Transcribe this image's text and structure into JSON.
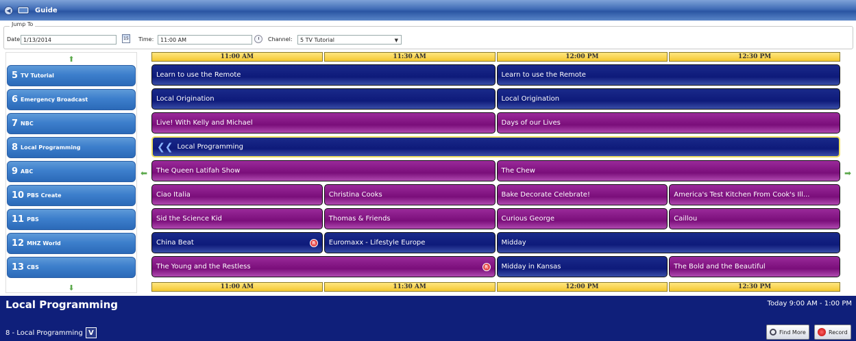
{
  "window": {
    "title": "Guide"
  },
  "jump_to": {
    "legend": "Jump To",
    "date_label": "Date:",
    "date_value": "1/13/2014",
    "calendar_day": "15",
    "time_label": "Time:",
    "time_value": "11:00 AM",
    "channel_label": "Channel:",
    "channel_value": "5 TV Tutorial"
  },
  "time_slots": [
    "11:00 AM",
    "11:30 AM",
    "12:00 PM",
    "12:30 PM"
  ],
  "channels": [
    {
      "num": "5",
      "name": "TV Tutorial"
    },
    {
      "num": "6",
      "name": "Emergency Broadcast"
    },
    {
      "num": "7",
      "name": "NBC"
    },
    {
      "num": "8",
      "name": "Local Programming"
    },
    {
      "num": "9",
      "name": "ABC"
    },
    {
      "num": "10",
      "name": "PBS Create"
    },
    {
      "num": "11",
      "name": "PBS"
    },
    {
      "num": "12",
      "name": "MHZ World"
    },
    {
      "num": "13",
      "name": "CBS"
    }
  ],
  "programs": [
    [
      {
        "title": "Learn to use the Remote",
        "start": 0,
        "span": 2,
        "color": "blue"
      },
      {
        "title": "Learn to use the Remote",
        "start": 2,
        "span": 2,
        "color": "blue"
      }
    ],
    [
      {
        "title": "Local Origination",
        "start": 0,
        "span": 2,
        "color": "blue"
      },
      {
        "title": "Local Origination",
        "start": 2,
        "span": 2,
        "color": "blue"
      }
    ],
    [
      {
        "title": "Live! With Kelly and Michael",
        "start": 0,
        "span": 2,
        "color": "mag"
      },
      {
        "title": "Days of our Lives",
        "start": 2,
        "span": 2,
        "color": "mag"
      }
    ],
    [
      {
        "title": "Local Programming",
        "start": 0,
        "span": 4,
        "color": "blue",
        "selected": true,
        "continues_before": true
      }
    ],
    [
      {
        "title": "The Queen Latifah Show",
        "start": 0,
        "span": 2,
        "color": "mag"
      },
      {
        "title": "The Chew",
        "start": 2,
        "span": 2,
        "color": "mag"
      }
    ],
    [
      {
        "title": "Ciao Italia",
        "start": 0,
        "span": 1,
        "color": "mag"
      },
      {
        "title": "Christina Cooks",
        "start": 1,
        "span": 1,
        "color": "mag"
      },
      {
        "title": "Bake Decorate Celebrate!",
        "start": 2,
        "span": 1,
        "color": "mag"
      },
      {
        "title": "America's Test Kitchen From Cook's Ill...",
        "start": 3,
        "span": 1,
        "color": "mag"
      }
    ],
    [
      {
        "title": "Sid the Science Kid",
        "start": 0,
        "span": 1,
        "color": "mag"
      },
      {
        "title": "Thomas & Friends",
        "start": 1,
        "span": 1,
        "color": "mag"
      },
      {
        "title": "Curious George",
        "start": 2,
        "span": 1,
        "color": "mag"
      },
      {
        "title": "Caillou",
        "start": 3,
        "span": 1,
        "color": "mag"
      }
    ],
    [
      {
        "title": "China Beat",
        "start": 0,
        "span": 1,
        "color": "blue",
        "record": true
      },
      {
        "title": "Euromaxx - Lifestyle Europe",
        "start": 1,
        "span": 1,
        "color": "blue"
      },
      {
        "title": "Midday",
        "start": 2,
        "span": 2,
        "color": "blue"
      }
    ],
    [
      {
        "title": "The Young and the Restless",
        "start": 0,
        "span": 2,
        "color": "mag",
        "record": true
      },
      {
        "title": "Midday in Kansas",
        "start": 2,
        "span": 1,
        "color": "blue"
      },
      {
        "title": "The Bold and the Beautiful",
        "start": 3,
        "span": 1,
        "color": "mag"
      }
    ]
  ],
  "info": {
    "title": "Local Programming",
    "time": "Today 9:00 AM - 1:00 PM",
    "channel": "8 - Local Programming",
    "v_label": "V",
    "find_more": "Find More",
    "record": "Record"
  },
  "colors": {
    "blue_program": "#0e1a7a",
    "magenta_program": "#7a0e7a",
    "time_header": "#f4c832",
    "channel_button": "#3d7fcc",
    "info_bar": "#0f1f7a"
  }
}
